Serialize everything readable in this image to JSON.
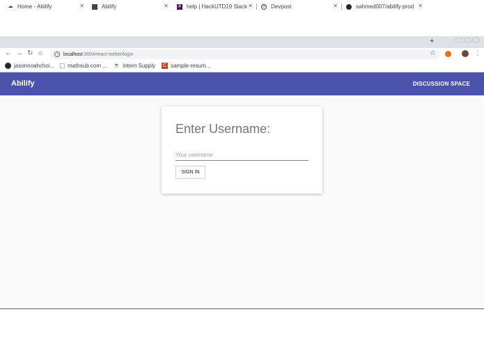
{
  "browser": {
    "tabs": [
      {
        "label": "Home - Abilify",
        "icon": "cloud-icon",
        "active": false
      },
      {
        "label": "Abilify",
        "icon": "app-icon",
        "active": true
      },
      {
        "label": "help | HackUTD19 Slack",
        "icon": "slack-icon",
        "active": false
      },
      {
        "label": "Devpost",
        "icon": "devpost-icon",
        "active": false
      },
      {
        "label": "sahmed007/abilify-prod",
        "icon": "github-icon",
        "active": false
      }
    ],
    "new_tab": "+",
    "address": {
      "host": "localhost",
      "path": ":3004/react-twitter/login"
    },
    "bookmarks": [
      {
        "label": "jasonnoahchoi...",
        "icon": "github-icon"
      },
      {
        "label": "mathsub.com ...",
        "icon": "page-icon"
      },
      {
        "label": "Intern Supply",
        "icon": "cup-icon"
      },
      {
        "label": "sample-resum...",
        "icon": "doc-icon"
      }
    ]
  },
  "app": {
    "brand": "Abilify",
    "nav_link": "DISCUSSION SPACE",
    "brand_color": "#4a52ab"
  },
  "login": {
    "title": "Enter Username:",
    "input_placeholder": "Your username",
    "input_value": "",
    "button_label": "SIGN IN"
  }
}
